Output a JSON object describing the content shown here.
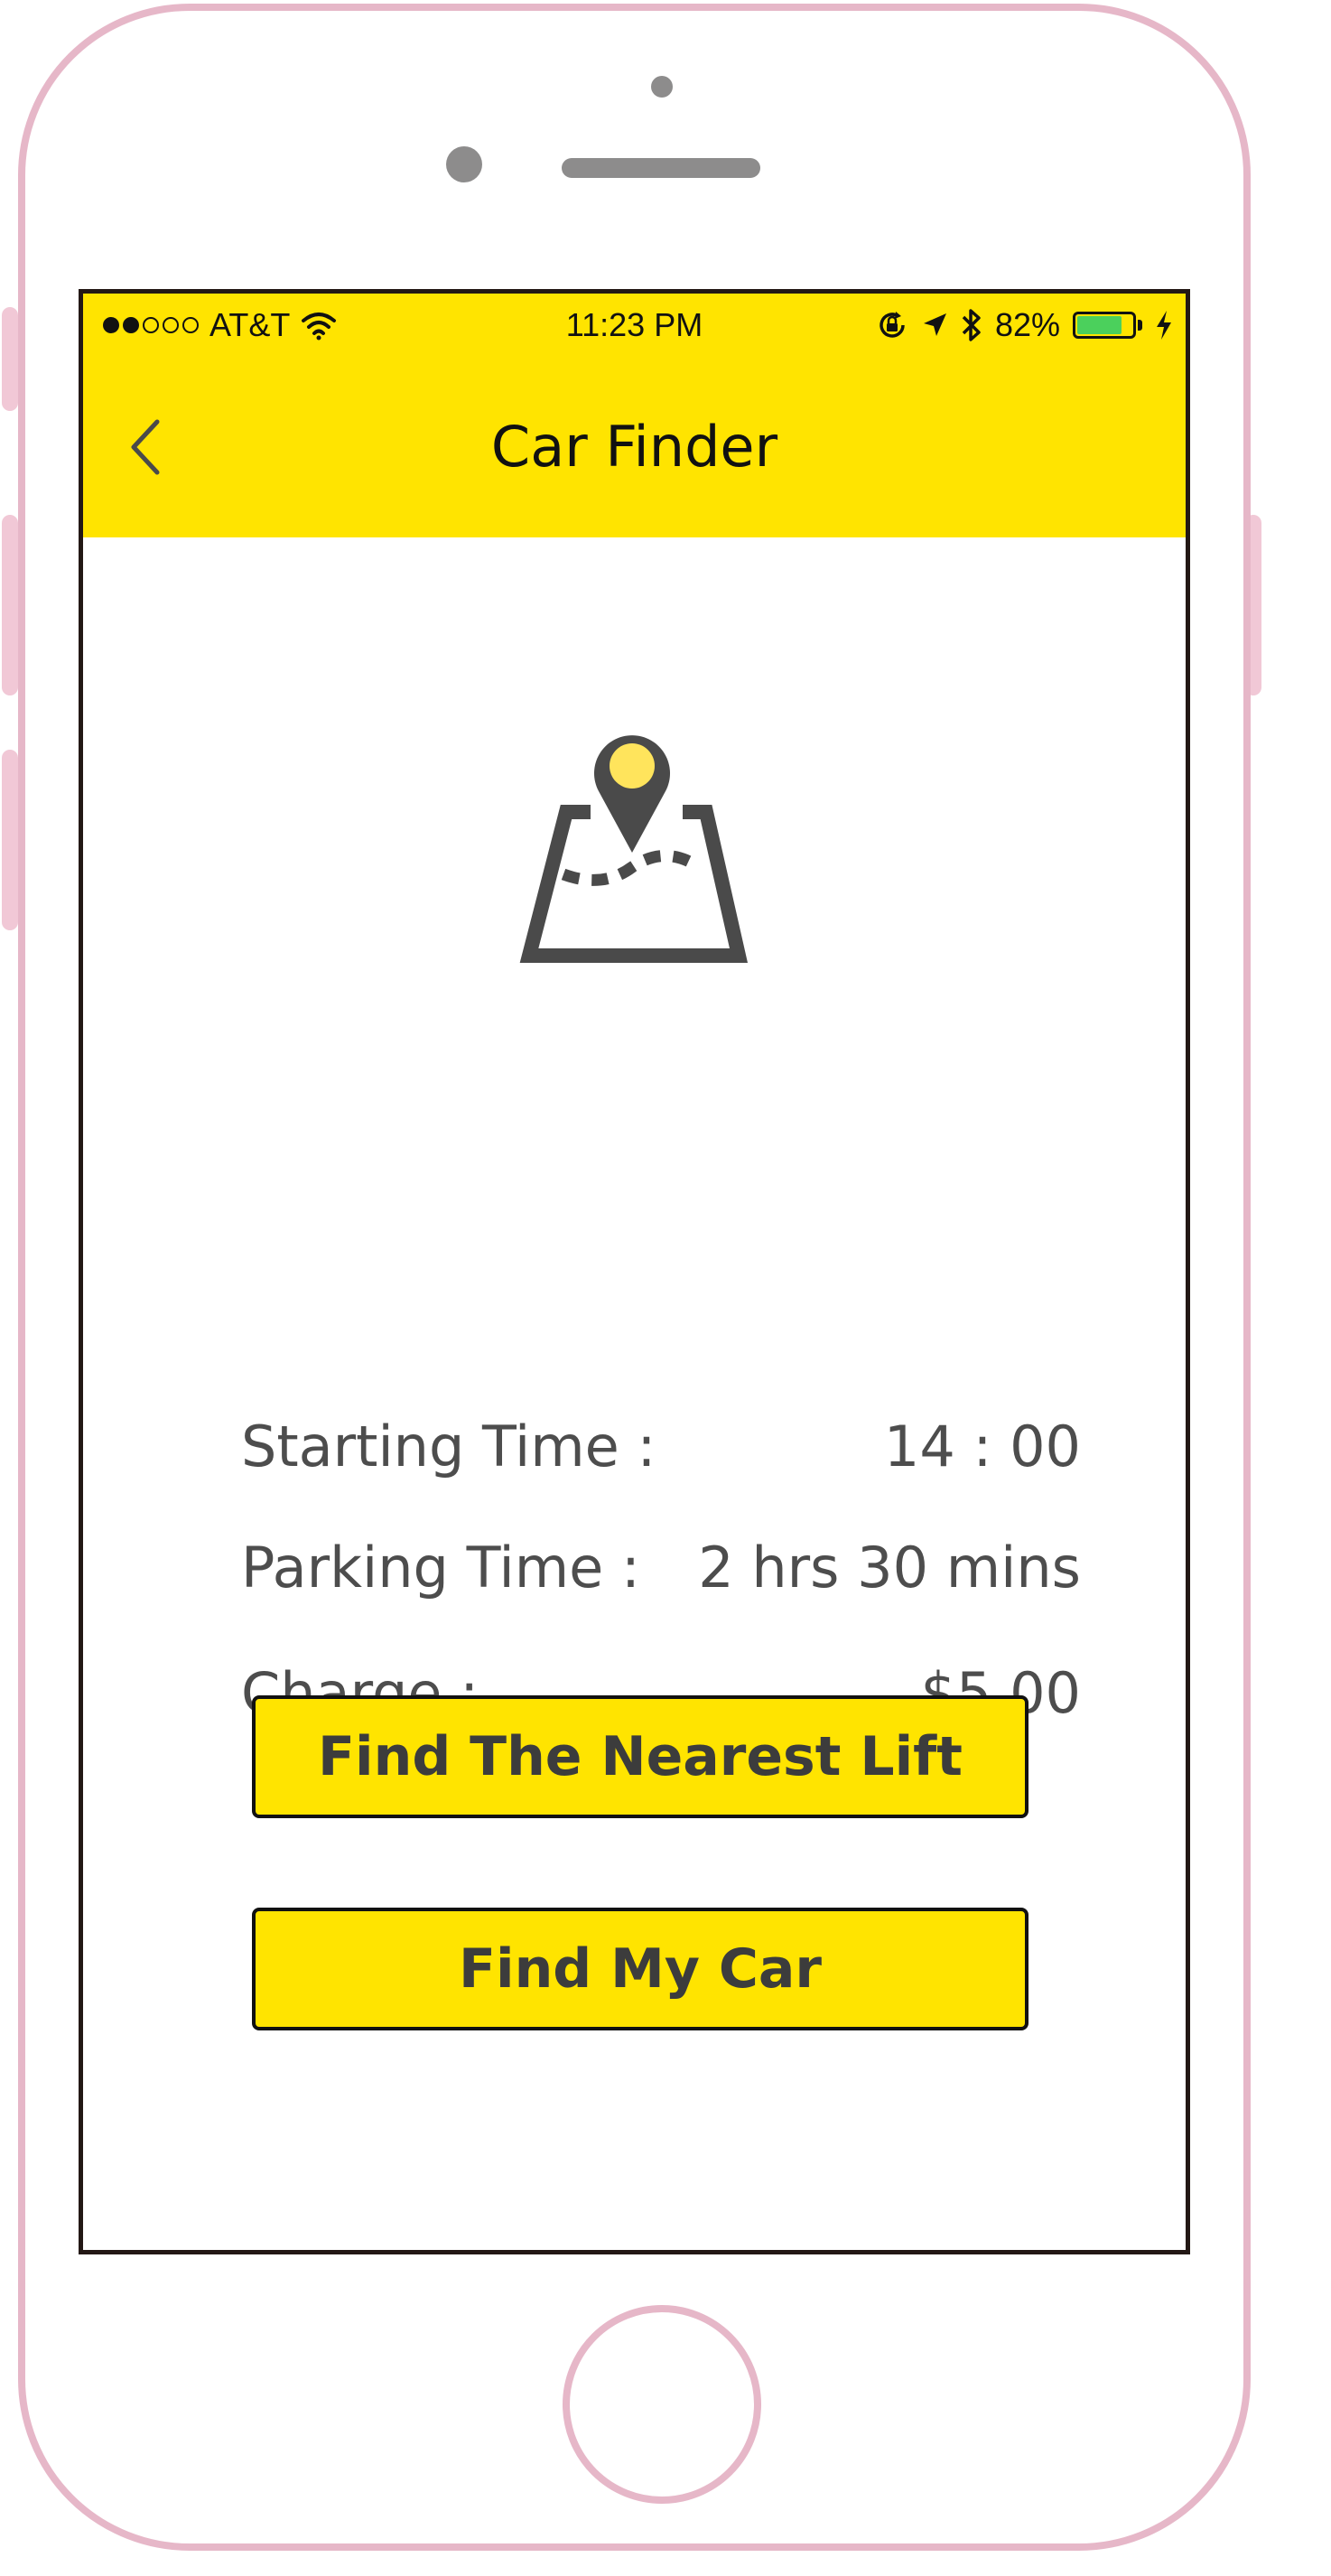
{
  "status_bar": {
    "carrier": "AT&T",
    "time": "11:23 PM",
    "battery_percent": "82%",
    "battery_level": 0.82,
    "signal_bars": 2,
    "signal_total": 5,
    "icons": [
      "wifi-icon",
      "orientation-lock-icon",
      "location-arrow-icon",
      "bluetooth-icon",
      "battery-icon",
      "charging-bolt-icon"
    ]
  },
  "nav": {
    "title": "Car Finder",
    "back_icon": "chevron-left-icon"
  },
  "illustration": {
    "icon": "map-pin-route-icon"
  },
  "info": [
    {
      "label": "Starting Time :",
      "value": "14 : 00"
    },
    {
      "label": "Parking Time :",
      "value": "2 hrs  30 mins"
    },
    {
      "label": "Charge :",
      "value": "$5.00"
    }
  ],
  "actions": {
    "nearest_lift": "Find The Nearest Lift",
    "find_car": "Find My Car"
  },
  "colors": {
    "accent_yellow": "#ffe400",
    "frame_pink": "#e6b7c8",
    "text_gray": "#4d4d4d",
    "icon_gray": "#4a4a4a",
    "pin_dot_yellow": "#ffe45c",
    "battery_green": "#4bd05c"
  }
}
